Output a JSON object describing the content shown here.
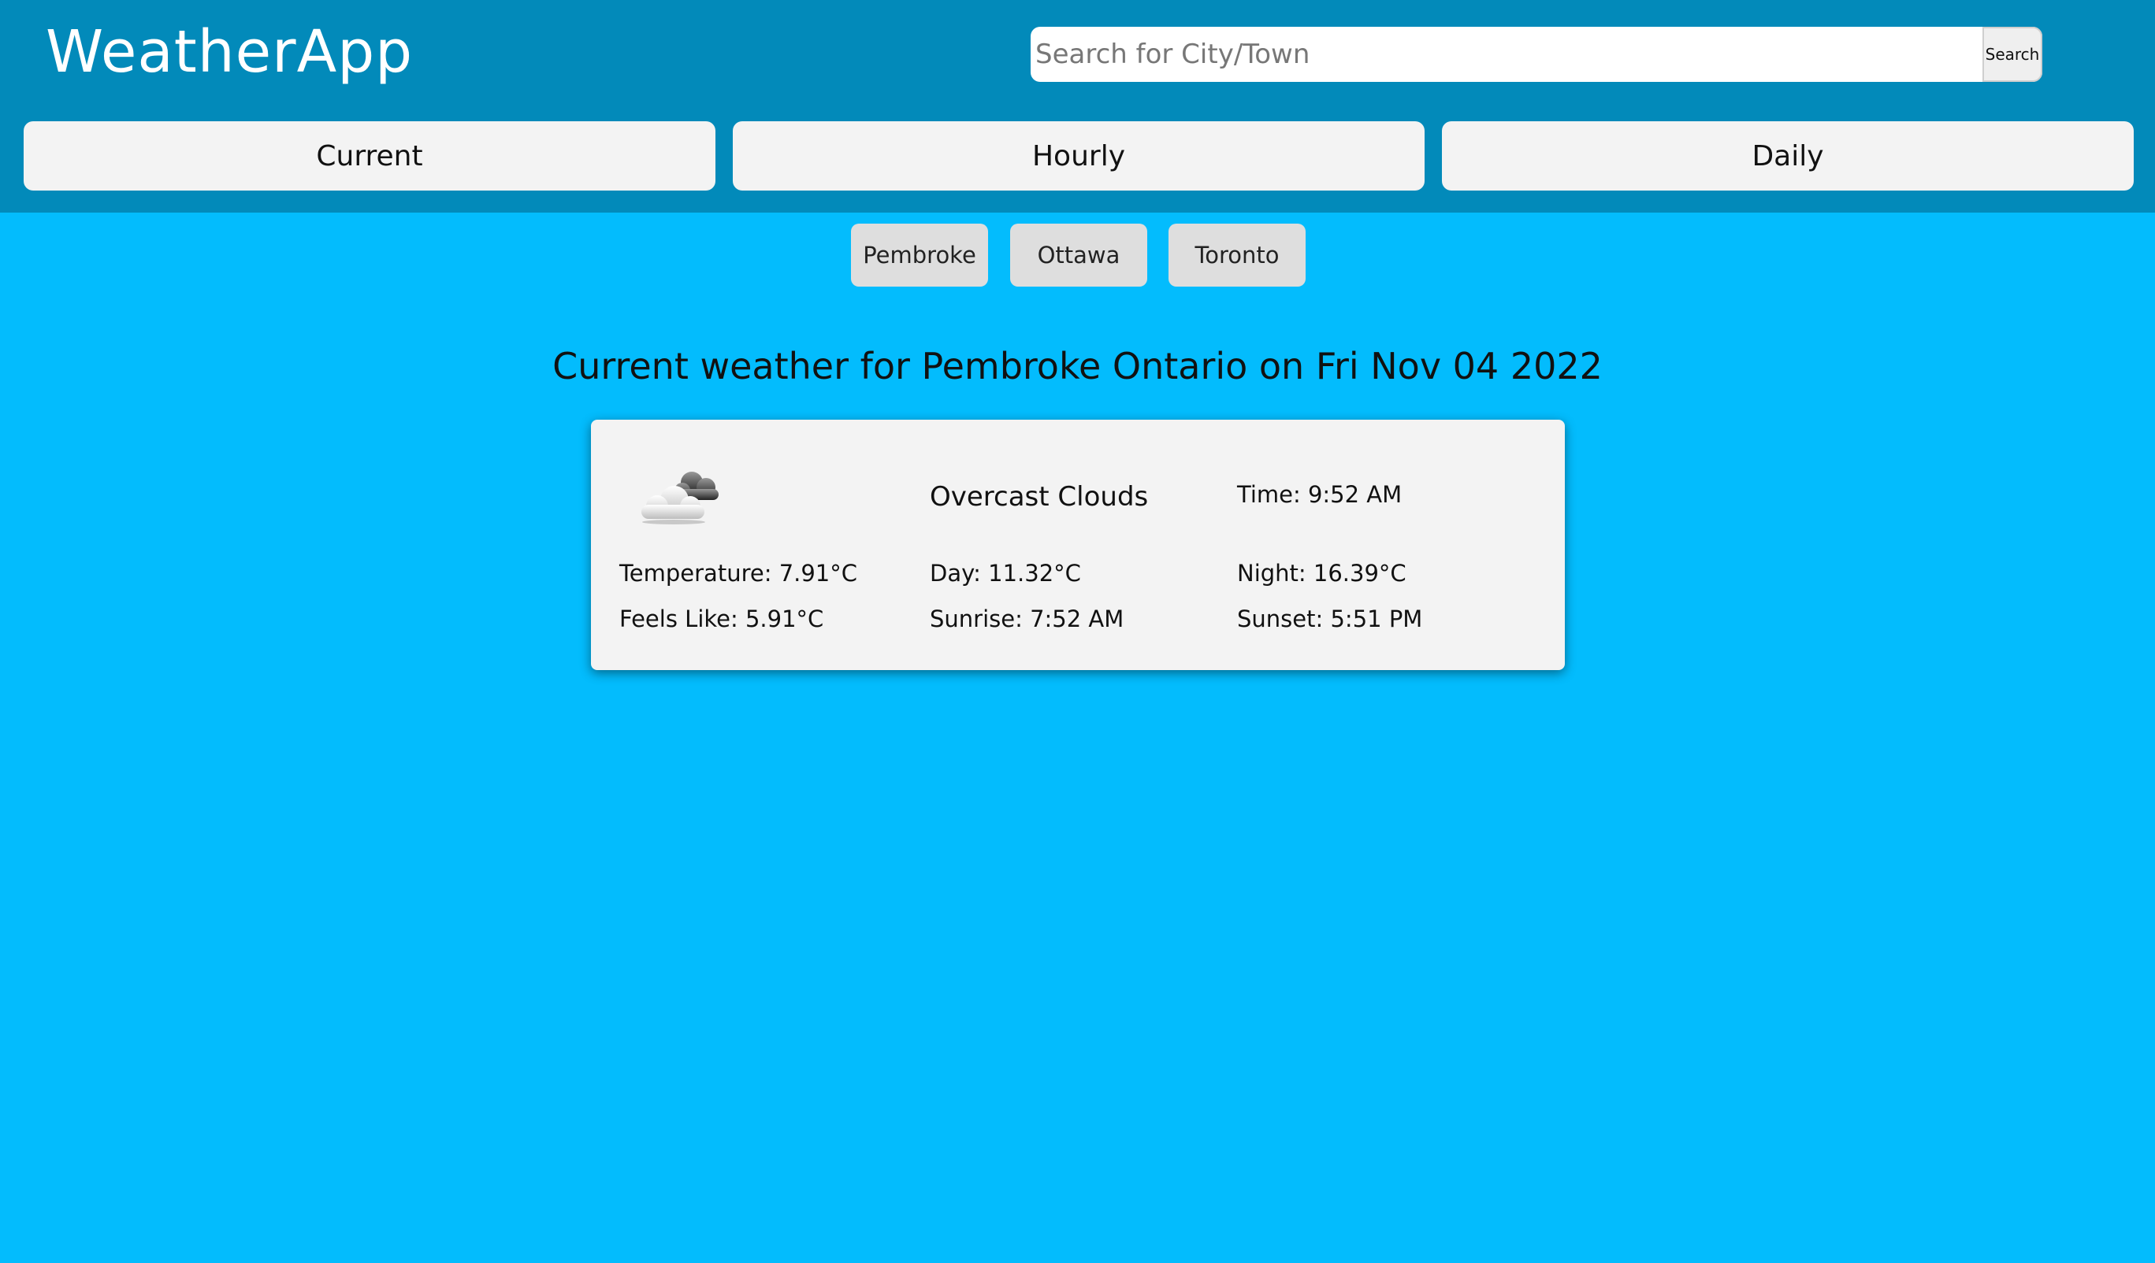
{
  "app": {
    "title": "WeatherApp"
  },
  "search": {
    "placeholder": "Search for City/Town",
    "value": "",
    "button_label": "Search"
  },
  "tabs": [
    {
      "label": "Current"
    },
    {
      "label": "Hourly"
    },
    {
      "label": "Daily"
    }
  ],
  "cities": [
    {
      "label": "Pembroke"
    },
    {
      "label": "Ottawa"
    },
    {
      "label": "Toronto"
    }
  ],
  "main": {
    "heading": "Current weather for Pembroke Ontario on Fri Nov 04 2022"
  },
  "card": {
    "icon": "overcast-clouds-icon",
    "condition": "Overcast Clouds",
    "time": "Time: 9:52 AM",
    "temperature": "Temperature: 7.91°C",
    "day": "Day: 11.32°C",
    "night": "Night: 16.39°C",
    "feels_like": "Feels Like: 5.91°C",
    "sunrise": "Sunrise: 7:52 AM",
    "sunset": "Sunset: 5:51 PM"
  },
  "colors": {
    "background": "#03bcfd",
    "header": "#028aba",
    "card": "#f3f3f3",
    "tab": "#f3f3f3",
    "city_button": "#dedede"
  }
}
